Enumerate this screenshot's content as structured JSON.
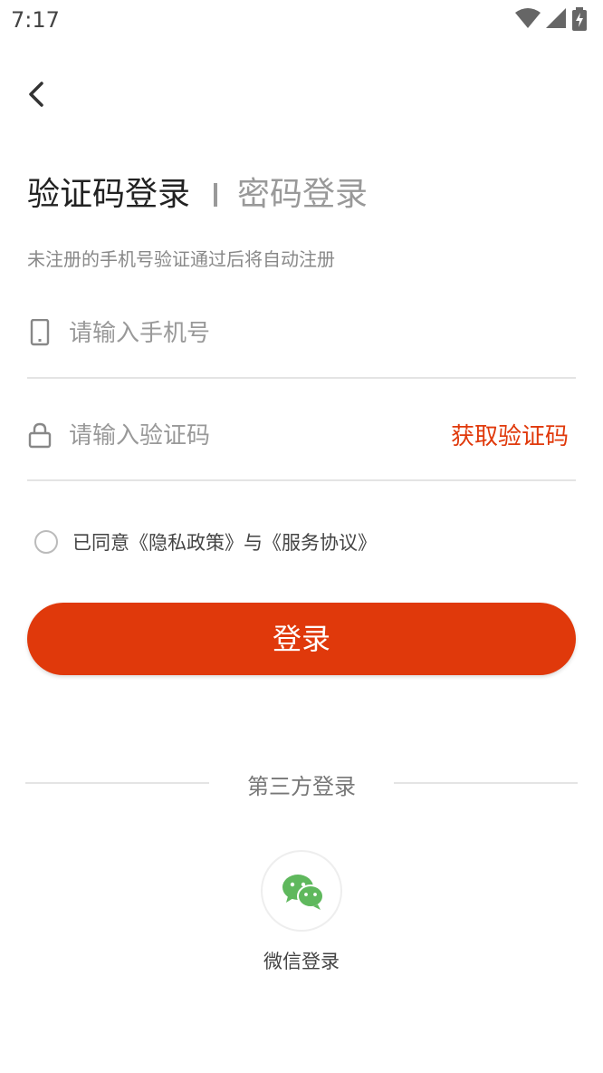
{
  "status_bar": {
    "time": "7:17",
    "icons": [
      "wifi-icon",
      "signal-icon",
      "battery-icon"
    ]
  },
  "header": {
    "back_icon": "chevron-left-icon"
  },
  "tabs": {
    "sms_login": "验证码登录",
    "password_login": "密码登录"
  },
  "hint": "未注册的手机号验证通过后将自动注册",
  "form": {
    "phone": {
      "placeholder": "请输入手机号",
      "value": "",
      "icon": "phone-icon"
    },
    "code": {
      "placeholder": "请输入验证码",
      "value": "",
      "icon": "lock-icon"
    },
    "get_code_label": "获取验证码"
  },
  "agreement": {
    "prefix": "已同意",
    "privacy": "《隐私政策》",
    "and": "与",
    "service": "《服务协议》",
    "checked": false
  },
  "login_button": "登录",
  "third_party": {
    "title": "第三方登录",
    "wechat_label": "微信登录",
    "wechat_icon": "wechat-icon"
  },
  "colors": {
    "accent": "#e0390b",
    "wechat": "#5fb85d",
    "muted": "#999999"
  }
}
